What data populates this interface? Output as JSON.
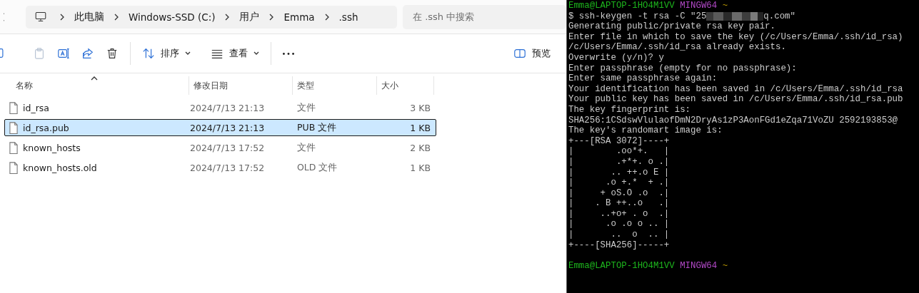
{
  "explorer": {
    "breadcrumb": [
      "此电脑",
      "Windows-SSD (C:)",
      "用户",
      "Emma",
      ".ssh"
    ],
    "search": {
      "placeholder": "在 .ssh 中搜索"
    },
    "toolbar": {
      "sort_label": "排序",
      "view_label": "查看",
      "preview_label": "预览"
    },
    "columns": [
      {
        "label": "名称",
        "sorted": true
      },
      {
        "label": "修改日期",
        "sorted": false
      },
      {
        "label": "类型",
        "sorted": false
      },
      {
        "label": "大小",
        "sorted": false
      }
    ],
    "files": [
      {
        "name": "id_rsa",
        "modified": "2024/7/13 21:13",
        "type": "文件",
        "size": "3 KB",
        "selected": false
      },
      {
        "name": "id_rsa.pub",
        "modified": "2024/7/13 21:13",
        "type": "PUB 文件",
        "size": "1 KB",
        "selected": true
      },
      {
        "name": "known_hosts",
        "modified": "2024/7/13 17:52",
        "type": "文件",
        "size": "2 KB",
        "selected": false
      },
      {
        "name": "known_hosts.old",
        "modified": "2024/7/13 17:52",
        "type": "OLD 文件",
        "size": "1 KB",
        "selected": false
      }
    ]
  },
  "terminal": {
    "lines": [
      {
        "kind": "prompt",
        "user": "Emma@LAPTOP-1HO4M1VV",
        "shell": "MINGW64",
        "path": "~"
      },
      {
        "kind": "redacted",
        "before": "$ ssh-keygen -t rsa -C \"25",
        "after": "q.com\""
      },
      {
        "kind": "text",
        "text": "Generating public/private rsa key pair."
      },
      {
        "kind": "text",
        "text": "Enter file in which to save the key (/c/Users/Emma/.ssh/id_rsa)"
      },
      {
        "kind": "text",
        "text": "/c/Users/Emma/.ssh/id_rsa already exists."
      },
      {
        "kind": "text",
        "text": "Overwrite (y/n)? y"
      },
      {
        "kind": "text",
        "text": "Enter passphrase (empty for no passphrase):"
      },
      {
        "kind": "text",
        "text": "Enter same passphrase again:"
      },
      {
        "kind": "text",
        "text": "Your identification has been saved in /c/Users/Emma/.ssh/id_rsa"
      },
      {
        "kind": "text",
        "text": "Your public key has been saved in /c/Users/Emma/.ssh/id_rsa.pub"
      },
      {
        "kind": "text",
        "text": "The key fingerprint is:"
      },
      {
        "kind": "text",
        "text": "SHA256:1CSdswVlulaofDmN2DryAs1zP3AonFGd1eZqa71VoZU 2592193853@"
      },
      {
        "kind": "text",
        "text": "The key's randomart image is:"
      },
      {
        "kind": "text",
        "text": "+---[RSA 3072]----+"
      },
      {
        "kind": "text",
        "text": "|        .oo*+.   |"
      },
      {
        "kind": "text",
        "text": "|        .+*+. o .|"
      },
      {
        "kind": "text",
        "text": "|       .. ++.o E |"
      },
      {
        "kind": "text",
        "text": "|      .o +.*  + .|"
      },
      {
        "kind": "text",
        "text": "|     + oS.O .o  .|"
      },
      {
        "kind": "text",
        "text": "|    . B ++..o   .|"
      },
      {
        "kind": "text",
        "text": "|     ..+o+ . o  .|"
      },
      {
        "kind": "text",
        "text": "|      .o .o o .. |"
      },
      {
        "kind": "text",
        "text": "|       ..  o  .. |"
      },
      {
        "kind": "text",
        "text": "+----[SHA256]-----+"
      },
      {
        "kind": "blank"
      },
      {
        "kind": "prompt",
        "user": "Emma@LAPTOP-1HO4M1VV",
        "shell": "MINGW64",
        "path": "~"
      }
    ]
  }
}
